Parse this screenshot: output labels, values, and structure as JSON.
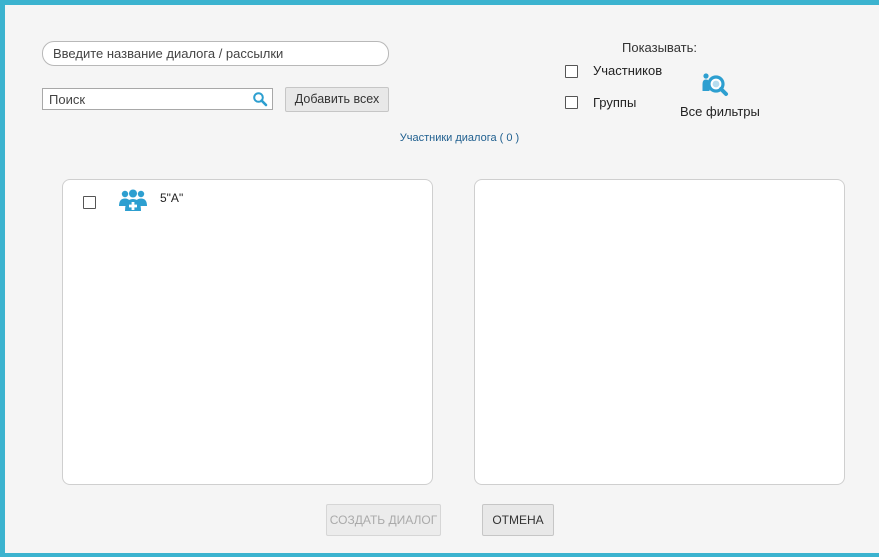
{
  "dialog_name": {
    "placeholder": "Введите название диалога / рассылки",
    "value": ""
  },
  "search": {
    "placeholder": "Поиск",
    "value": "",
    "icon": "search-icon"
  },
  "add_all_label": "Добавить всех",
  "show": {
    "title": "Показывать:",
    "options": [
      {
        "label": "Участников",
        "checked": false
      },
      {
        "label": "Группы",
        "checked": false
      }
    ]
  },
  "filters": {
    "label": "Все фильтры",
    "icon": "filter-search-icon"
  },
  "participants_count_label": "Участники диалога ( 0 )",
  "available_list": [
    {
      "label": "5\"А\"",
      "checked": false,
      "icon": "add-group-icon"
    }
  ],
  "selected_list": [],
  "buttons": {
    "create_label": "СОЗДАТЬ ДИАЛОГ",
    "cancel_label": "ОТМЕНА"
  },
  "colors": {
    "accent": "#3bb3cf",
    "icon_blue": "#2d9fd0",
    "link_text": "#1f5f8f",
    "background": "#f5f5f5"
  }
}
